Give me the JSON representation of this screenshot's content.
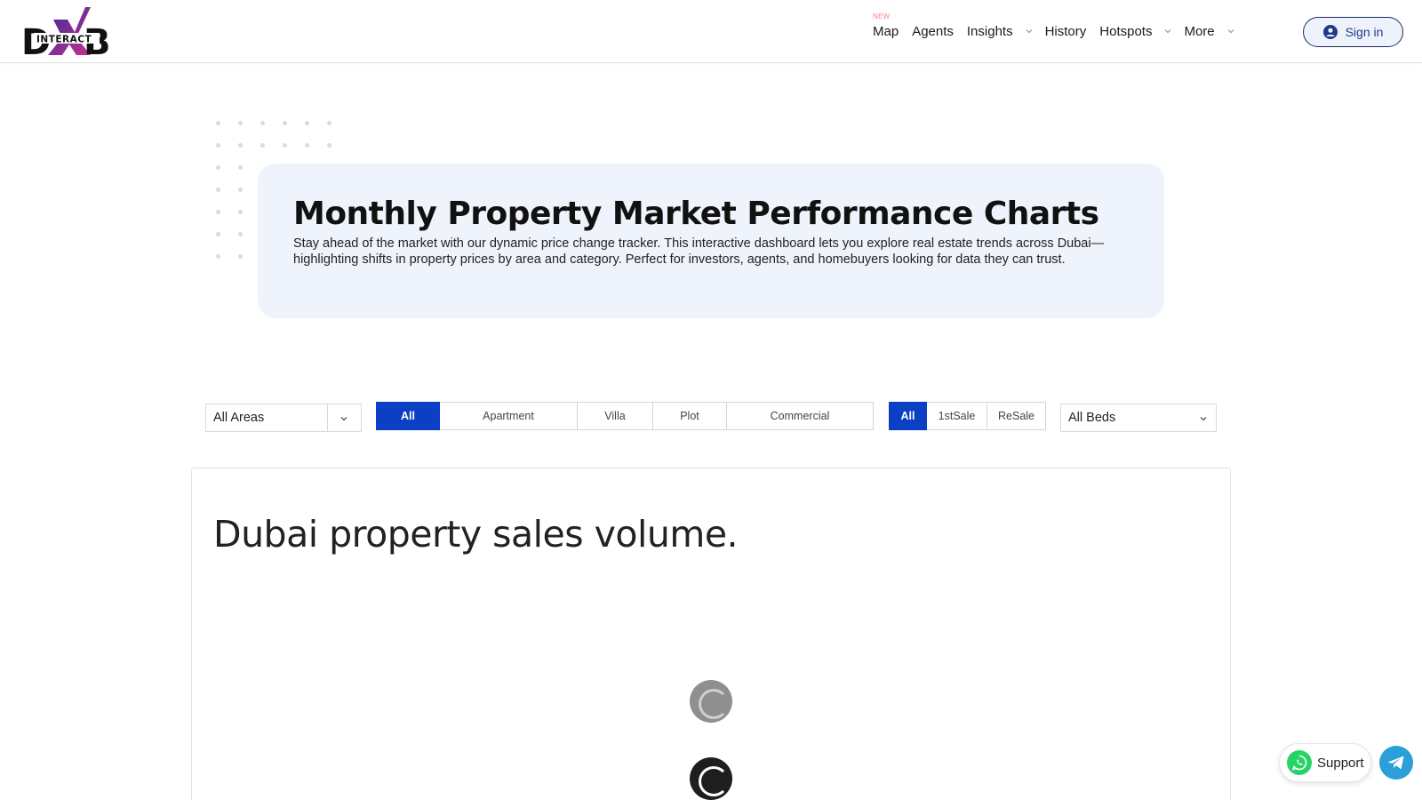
{
  "header": {
    "logo_text": "DXB INTERACT",
    "nav": [
      {
        "label": "Map",
        "badge": "NEW",
        "dropdown": false
      },
      {
        "label": "Agents",
        "dropdown": false
      },
      {
        "label": "Insights",
        "dropdown": true
      },
      {
        "label": "History",
        "dropdown": false
      },
      {
        "label": "Hotspots",
        "dropdown": true
      },
      {
        "label": "More",
        "dropdown": true
      }
    ],
    "signin_label": "Sign in"
  },
  "hero": {
    "title": "Monthly Property Market Performance Charts",
    "description": "Stay ahead of the market with our dynamic price change tracker. This interactive dashboard lets you explore real estate trends across Dubai—highlighting shifts in property prices by area and category. Perfect for investors, agents, and homebuyers looking for data they can trust."
  },
  "filters": {
    "area_select": "All Areas",
    "property_types": [
      "All",
      "Apartment",
      "Villa",
      "Plot",
      "Commercial"
    ],
    "property_type_selected": "All",
    "sale_types": [
      "All",
      "1stSale",
      "ReSale"
    ],
    "sale_type_selected": "All",
    "beds_select": "All Beds"
  },
  "card": {
    "title": "Dubai property sales volume."
  },
  "floating": {
    "support_label": "Support"
  },
  "colors": {
    "accent": "#0b3fc4",
    "hero_bg": "#eef3fc",
    "signin_border": "#1c2d5e",
    "whatsapp": "#25d366",
    "telegram": "#2a9fd8"
  }
}
